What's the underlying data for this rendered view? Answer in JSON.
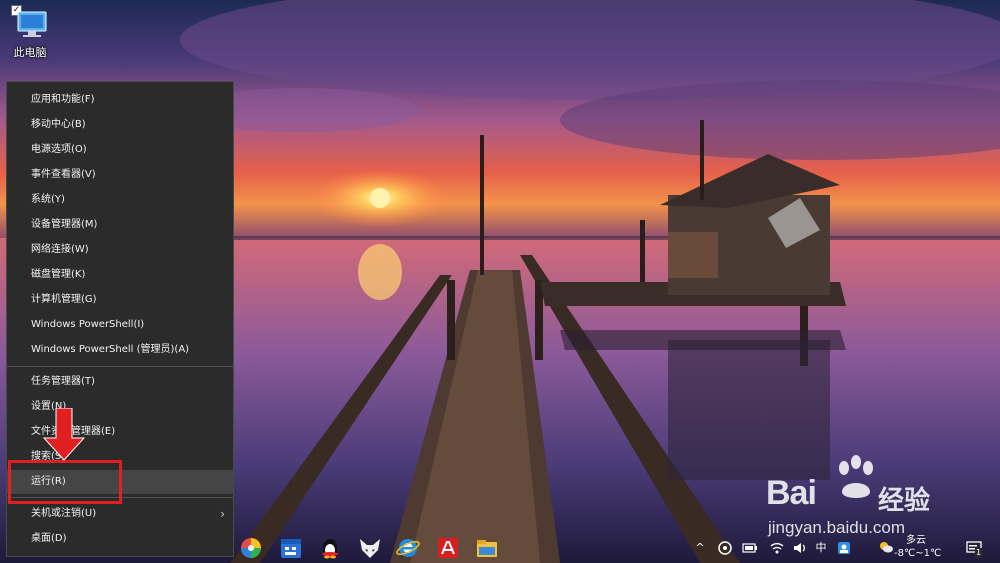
{
  "desktop": {
    "icons": [
      {
        "label": "此电脑",
        "icon": "computer-icon"
      }
    ]
  },
  "winx_menu": {
    "items": [
      {
        "label": "应用和功能(F)"
      },
      {
        "label": "移动中心(B)"
      },
      {
        "label": "电源选项(O)"
      },
      {
        "label": "事件查看器(V)"
      },
      {
        "label": "系统(Y)"
      },
      {
        "label": "设备管理器(M)"
      },
      {
        "label": "网络连接(W)"
      },
      {
        "label": "磁盘管理(K)"
      },
      {
        "label": "计算机管理(G)"
      },
      {
        "label": "Windows PowerShell(I)"
      },
      {
        "label": "Windows PowerShell (管理员)(A)"
      },
      {
        "label": "任务管理器(T)"
      },
      {
        "label": "设置(N)"
      },
      {
        "label": "文件资源管理器(E)"
      },
      {
        "label": "搜索(S)"
      },
      {
        "label": "运行(R)",
        "highlighted": true
      },
      {
        "label": "关机或注销(U)",
        "has_submenu": true
      },
      {
        "label": "桌面(D)"
      }
    ],
    "submenu_arrow": "›"
  },
  "annotation": {
    "color": "#e02020",
    "arrow_icon": "down-arrow-icon"
  },
  "watermark": {
    "brand_left": "Bai",
    "brand_right": "经验",
    "url": "jingyan.baidu.com",
    "icon": "baidu-paw-icon"
  },
  "taskbar": {
    "apps": [
      {
        "icon": "pinwheel-app-icon"
      },
      {
        "icon": "calendar-app-icon"
      },
      {
        "icon": "qq-penguin-icon"
      },
      {
        "icon": "fox-app-icon"
      },
      {
        "icon": "internet-explorer-icon"
      },
      {
        "icon": "acrobat-reader-icon"
      },
      {
        "icon": "file-explorer-icon"
      }
    ],
    "tray": {
      "chevron": "^",
      "ime": "中",
      "weather": {
        "condition": "多云",
        "temperature": "-8℃~1℃"
      },
      "notification_count": "1"
    }
  }
}
